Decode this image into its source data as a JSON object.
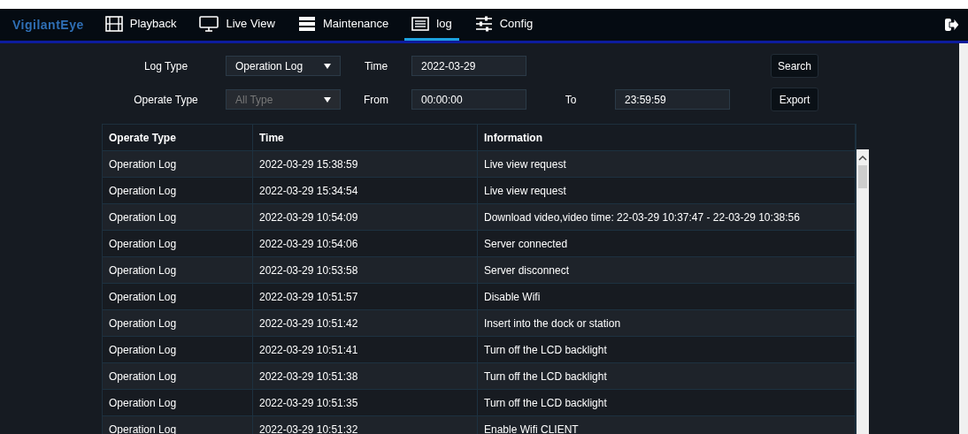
{
  "brand": "VigilantEye",
  "nav": [
    {
      "label": "Playback",
      "selected": false
    },
    {
      "label": "Live View",
      "selected": false
    },
    {
      "label": "Maintenance",
      "selected": false
    },
    {
      "label": "log",
      "selected": true
    },
    {
      "label": "Config",
      "selected": false
    }
  ],
  "filters": {
    "log_type": {
      "label": "Log Type",
      "value": "Operation Log",
      "disabled": false
    },
    "operate_type": {
      "label": "Operate Type",
      "value": "All Type",
      "disabled": true
    },
    "time": {
      "label": "Time",
      "value": "2022-03-29"
    },
    "from": {
      "label": "From",
      "value": "00:00:00"
    },
    "to": {
      "label": "To",
      "value": "23:59:59"
    },
    "buttons": [
      "Search",
      "Export"
    ]
  },
  "table": {
    "columns": [
      "Operate Type",
      "Time",
      "Information"
    ],
    "rows": [
      [
        "Operation Log",
        "2022-03-29 15:38:59",
        "Live view request"
      ],
      [
        "Operation Log",
        "2022-03-29 15:34:54",
        "Live view request"
      ],
      [
        "Operation Log",
        "2022-03-29 10:54:09",
        "Download video,video time: 22-03-29 10:37:47 - 22-03-29 10:38:56"
      ],
      [
        "Operation Log",
        "2022-03-29 10:54:06",
        "Server connected"
      ],
      [
        "Operation Log",
        "2022-03-29 10:53:58",
        "Server disconnect"
      ],
      [
        "Operation Log",
        "2022-03-29 10:51:57",
        "Disable Wifi"
      ],
      [
        "Operation Log",
        "2022-03-29 10:51:42",
        "Insert into the dock or station"
      ],
      [
        "Operation Log",
        "2022-03-29 10:51:41",
        "Turn off the LCD backlight"
      ],
      [
        "Operation Log",
        "2022-03-29 10:51:38",
        "Turn off the LCD backlight"
      ],
      [
        "Operation Log",
        "2022-03-29 10:51:35",
        "Turn off the LCD backlight"
      ],
      [
        "Operation Log",
        "2022-03-29 10:51:32",
        "Enable Wifi CLIENT"
      ]
    ]
  }
}
